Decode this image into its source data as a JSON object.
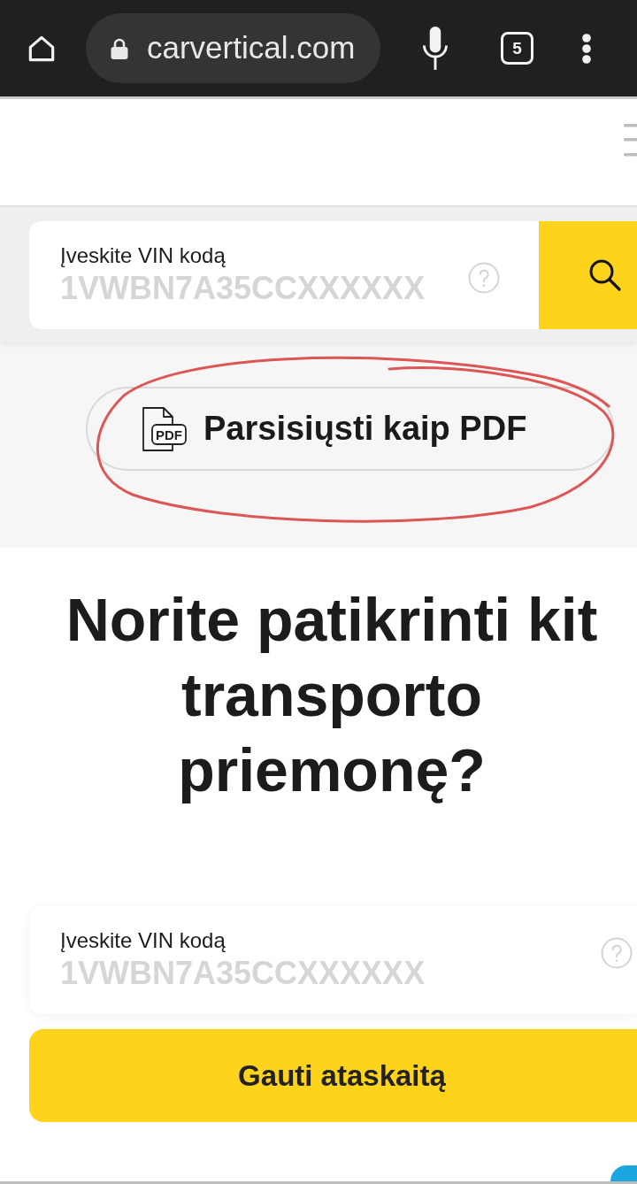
{
  "browser": {
    "url": "carvertical.com",
    "tab_count": "5"
  },
  "search_bar": {
    "label": "Įveskite VIN kodą",
    "placeholder": "1VWBN7A35CCXXXXXX"
  },
  "pdf_button": {
    "icon_label": "PDF",
    "label": "Parsisiųsti kaip PDF",
    "circled": true
  },
  "cta": {
    "heading": "Norite patikrinti kit\ntransporto\npriemonę?",
    "field": {
      "label": "Įveskite VIN kodą",
      "placeholder": "1VWBN7A35CCXXXXXX"
    },
    "button": "Gauti ataskaitą"
  }
}
